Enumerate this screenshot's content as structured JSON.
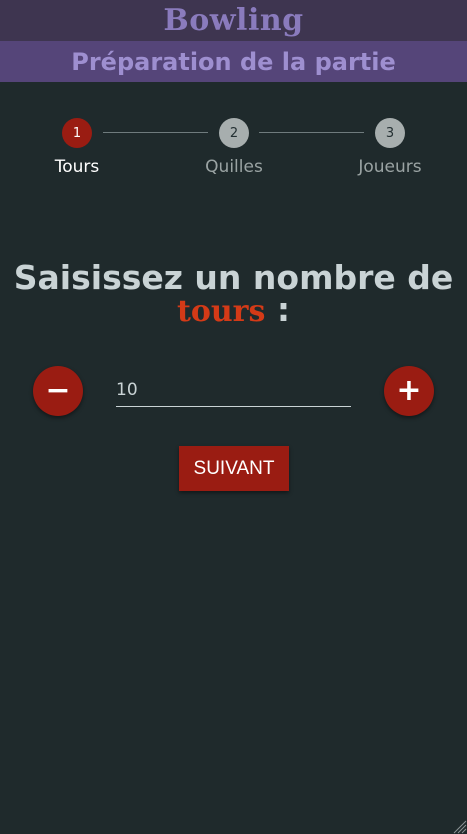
{
  "header": {
    "app_title": "Bowling",
    "subtitle": "Préparation de la partie"
  },
  "stepper": {
    "active_step": 1,
    "steps": [
      {
        "number": "1",
        "label": "Tours"
      },
      {
        "number": "2",
        "label": "Quilles"
      },
      {
        "number": "3",
        "label": "Joueurs"
      }
    ]
  },
  "main": {
    "prompt_before": "Saisissez un nombre de",
    "prompt_highlight": "tours",
    "prompt_after": " :",
    "decrement_symbol": "−",
    "increment_symbol": "+",
    "input_value": "10",
    "next_label": "SUIVANT"
  },
  "colors": {
    "background": "#1f2a2c",
    "title_bar": "#3e3550",
    "subtitle_bar": "#554579",
    "accent_red": "#9a1c12",
    "highlight_orange": "#d43a17"
  },
  "icons": {
    "decrement": "minus-icon",
    "increment": "plus-icon",
    "corner": "resize-grip-icon"
  }
}
